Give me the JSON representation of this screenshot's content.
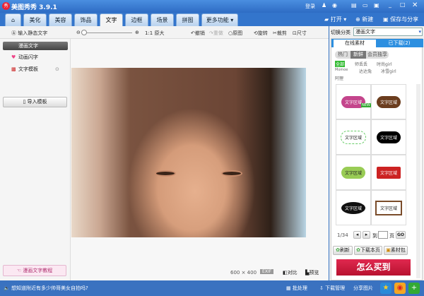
{
  "app": {
    "title": "美图秀秀 3.9.1",
    "logo": "秀",
    "login": "登录"
  },
  "tabs": [
    "美化",
    "美容",
    "饰品",
    "文字",
    "边框",
    "场景",
    "拼图",
    "更多功能 ▾"
  ],
  "top_actions": {
    "open": "打开 ▾",
    "new": "新建",
    "save_share": "保存与分享"
  },
  "toolbar": {
    "zoom_actual": "1:1 原大",
    "undo": "撤销",
    "redo": "重做",
    "original": "原图",
    "rotate": "旋转",
    "crop": "裁剪",
    "size": "尺寸"
  },
  "left": {
    "items": [
      "输入静态文字",
      "漫画文字",
      "动画闪字",
      "文字模板"
    ],
    "import": "导入模板",
    "tutorial": "漫画文字教程"
  },
  "canvas": {
    "dimensions": "600 × 400",
    "exif": "EXIF",
    "compare": "对比",
    "preview": "预览"
  },
  "right": {
    "category_label": "切换分类",
    "category_value": "漫画文字",
    "tabs": [
      "在线素材",
      "已下载(2)"
    ],
    "filters": [
      "热门",
      "新鲜",
      "会员独享"
    ],
    "tags": [
      "全部",
      "师丢丢",
      "时尚girl",
      "Momoe",
      "达达兔",
      "冰雪girl",
      "阿狸"
    ],
    "material_text": "文字区域",
    "new_badge": "NEW",
    "page": "1/34",
    "goto": "到",
    "page_unit": "页",
    "go": "GO",
    "refresh": "刷新",
    "download_page": "下载本页",
    "package": "素材包",
    "banner": "怎么买到"
  },
  "status": {
    "message": "想知道附近有多少帅哥美女自拍吗?",
    "batch": "批处理",
    "download_mgr": "下载管理",
    "share_pic": "分享图片"
  }
}
